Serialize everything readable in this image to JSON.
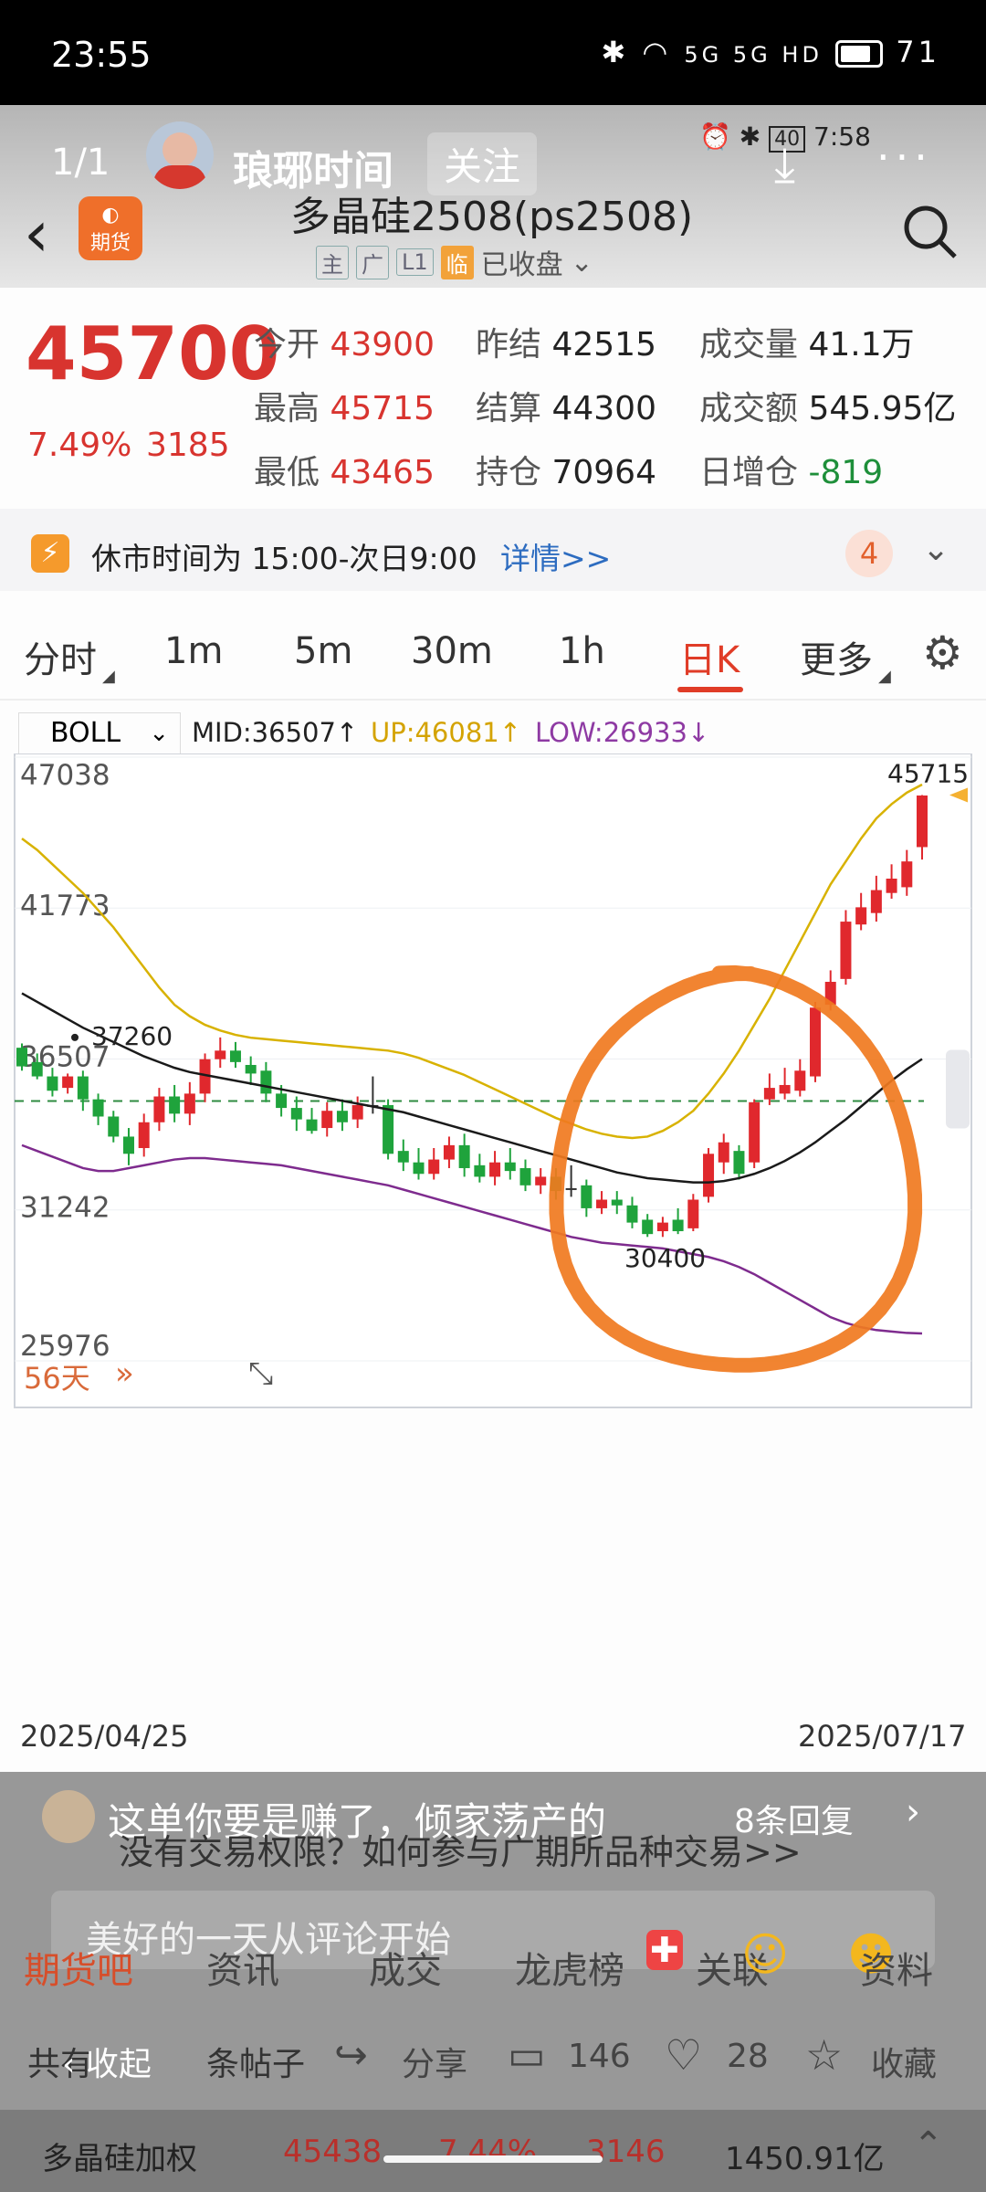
{
  "status_bar": {
    "time": "23:55",
    "battery": "71",
    "network": "5G 5G HD"
  },
  "viewer": {
    "page_counter": "1/1",
    "author": "琅琊时间",
    "follow": "关注",
    "inner_time": "7:58",
    "inner_battery": "40"
  },
  "header": {
    "title": "多晶硅2508(ps2508)",
    "logo_text": "期货",
    "badges": [
      "主",
      "广",
      "L1",
      "临"
    ],
    "status": "已收盘"
  },
  "quote": {
    "price": "45700",
    "change_pct": "7.49%",
    "change": "3185",
    "rows": [
      [
        {
          "label": "今开",
          "value": "43900",
          "color": "red"
        },
        {
          "label": "昨结",
          "value": "42515",
          "color": "dark"
        },
        {
          "label": "成交量",
          "value": "41.1万",
          "color": "dark"
        }
      ],
      [
        {
          "label": "最高",
          "value": "45715",
          "color": "red"
        },
        {
          "label": "结算",
          "value": "44300",
          "color": "dark"
        },
        {
          "label": "成交额",
          "value": "545.95亿",
          "color": "dark"
        }
      ],
      [
        {
          "label": "最低",
          "value": "43465",
          "color": "red"
        },
        {
          "label": "持仓",
          "value": "70964",
          "color": "dark"
        },
        {
          "label": "日增仓",
          "value": "-819",
          "color": "green"
        }
      ]
    ]
  },
  "notice": {
    "text": "休市时间为 15:00-次日9:00",
    "link": "详情>>",
    "count": "4"
  },
  "timeframe_tabs": [
    "分时",
    "1m",
    "5m",
    "30m",
    "1h",
    "日K",
    "更多"
  ],
  "active_tab": "日K",
  "indicator": {
    "name": "BOLL",
    "mid": "MID:36507↑",
    "up": "UP:46081↑",
    "low": "LOW:26933↓"
  },
  "chart_data": {
    "type": "candlestick",
    "x_start": "2025/04/25",
    "x_end": "2025/07/17",
    "y_ticks": [
      "47038",
      "41773",
      "36507",
      "31242",
      "25976"
    ],
    "ylim": [
      25976,
      47038
    ],
    "max_label": "45715",
    "min_label": "30400",
    "prev_label": "37260",
    "period_label": "56天",
    "candles": [
      {
        "o": 36900,
        "c": 36250,
        "h": 37050,
        "l": 36100
      },
      {
        "o": 36400,
        "c": 35900,
        "h": 36700,
        "l": 35800
      },
      {
        "o": 35900,
        "c": 35400,
        "h": 36200,
        "l": 35200
      },
      {
        "o": 35500,
        "c": 35900,
        "h": 36000,
        "l": 35300
      },
      {
        "o": 35900,
        "c": 35100,
        "h": 36100,
        "l": 34700
      },
      {
        "o": 35100,
        "c": 34500,
        "h": 35300,
        "l": 34200
      },
      {
        "o": 34500,
        "c": 33800,
        "h": 34700,
        "l": 33600
      },
      {
        "o": 33800,
        "c": 33200,
        "h": 34100,
        "l": 32800
      },
      {
        "o": 33400,
        "c": 34300,
        "h": 34600,
        "l": 33100
      },
      {
        "o": 34300,
        "c": 35200,
        "h": 35500,
        "l": 34000
      },
      {
        "o": 35200,
        "c": 34600,
        "h": 35600,
        "l": 34300
      },
      {
        "o": 34600,
        "c": 35300,
        "h": 35700,
        "l": 34200
      },
      {
        "o": 35300,
        "c": 36500,
        "h": 36700,
        "l": 35000
      },
      {
        "o": 36500,
        "c": 36800,
        "h": 37260,
        "l": 36200
      },
      {
        "o": 36800,
        "c": 36400,
        "h": 37100,
        "l": 36200
      },
      {
        "o": 36300,
        "c": 36000,
        "h": 36600,
        "l": 35600
      },
      {
        "o": 36100,
        "c": 35300,
        "h": 36400,
        "l": 35000
      },
      {
        "o": 35300,
        "c": 34800,
        "h": 35600,
        "l": 34500
      },
      {
        "o": 34800,
        "c": 34400,
        "h": 35200,
        "l": 34000
      },
      {
        "o": 34400,
        "c": 34000,
        "h": 34800,
        "l": 33900
      },
      {
        "o": 34100,
        "c": 34700,
        "h": 35000,
        "l": 33800
      },
      {
        "o": 34700,
        "c": 34300,
        "h": 35100,
        "l": 34000
      },
      {
        "o": 34400,
        "c": 34900,
        "h": 35200,
        "l": 34100
      },
      {
        "o": 34900,
        "c": 34900,
        "h": 35900,
        "l": 34600
      },
      {
        "o": 34900,
        "c": 33200,
        "h": 35100,
        "l": 33000
      },
      {
        "o": 33300,
        "c": 32900,
        "h": 33700,
        "l": 32600
      },
      {
        "o": 32900,
        "c": 32500,
        "h": 33400,
        "l": 32300
      },
      {
        "o": 32500,
        "c": 33000,
        "h": 33400,
        "l": 32300
      },
      {
        "o": 33000,
        "c": 33500,
        "h": 33800,
        "l": 32700
      },
      {
        "o": 33500,
        "c": 32700,
        "h": 33900,
        "l": 32400
      },
      {
        "o": 32800,
        "c": 32400,
        "h": 33200,
        "l": 32200
      },
      {
        "o": 32400,
        "c": 32900,
        "h": 33300,
        "l": 32100
      },
      {
        "o": 32900,
        "c": 32600,
        "h": 33400,
        "l": 32300
      },
      {
        "o": 32700,
        "c": 32100,
        "h": 33000,
        "l": 31900
      },
      {
        "o": 32100,
        "c": 32400,
        "h": 32700,
        "l": 31800
      },
      {
        "o": 32400,
        "c": 31900,
        "h": 32700,
        "l": 31600
      },
      {
        "o": 32000,
        "c": 32000,
        "h": 32800,
        "l": 31700
      },
      {
        "o": 32100,
        "c": 31300,
        "h": 32300,
        "l": 31000
      },
      {
        "o": 31300,
        "c": 31600,
        "h": 31900,
        "l": 31100
      },
      {
        "o": 31600,
        "c": 31400,
        "h": 31900,
        "l": 31100
      },
      {
        "o": 31400,
        "c": 30800,
        "h": 31700,
        "l": 30600
      },
      {
        "o": 30900,
        "c": 30400,
        "h": 31100,
        "l": 30300
      },
      {
        "o": 30500,
        "c": 30800,
        "h": 31000,
        "l": 30300
      },
      {
        "o": 30900,
        "c": 30500,
        "h": 31300,
        "l": 30400
      },
      {
        "o": 30600,
        "c": 31600,
        "h": 31800,
        "l": 30500
      },
      {
        "o": 31700,
        "c": 33200,
        "h": 33400,
        "l": 31500
      },
      {
        "o": 32900,
        "c": 33600,
        "h": 33900,
        "l": 32500
      },
      {
        "o": 33300,
        "c": 32500,
        "h": 33500,
        "l": 32300
      },
      {
        "o": 32900,
        "c": 35000,
        "h": 35100,
        "l": 32700
      },
      {
        "o": 35100,
        "c": 35500,
        "h": 36000,
        "l": 34900
      },
      {
        "o": 35300,
        "c": 35600,
        "h": 36200,
        "l": 35100
      },
      {
        "o": 35400,
        "c": 36100,
        "h": 36500,
        "l": 35200
      },
      {
        "o": 35900,
        "c": 38300,
        "h": 38500,
        "l": 35700
      },
      {
        "o": 38400,
        "c": 39200,
        "h": 39600,
        "l": 38200
      },
      {
        "o": 39300,
        "c": 41300,
        "h": 41700,
        "l": 39100
      },
      {
        "o": 41200,
        "c": 41800,
        "h": 42300,
        "l": 41000
      },
      {
        "o": 41600,
        "c": 42400,
        "h": 42900,
        "l": 41300
      },
      {
        "o": 42300,
        "c": 42800,
        "h": 43300,
        "l": 42100
      },
      {
        "o": 42500,
        "c": 43400,
        "h": 43800,
        "l": 42200
      },
      {
        "o": 43900,
        "c": 45700,
        "h": 45715,
        "l": 43465
      }
    ],
    "boll_mid": [
      38800,
      38500,
      38200,
      37900,
      37600,
      37350,
      37100,
      36850,
      36600,
      36400,
      36200,
      36050,
      35950,
      35850,
      35750,
      35650,
      35550,
      35450,
      35350,
      35250,
      35150,
      35050,
      34950,
      34850,
      34750,
      34650,
      34500,
      34350,
      34200,
      34050,
      33900,
      33750,
      33600,
      33450,
      33300,
      33150,
      33000,
      32850,
      32700,
      32550,
      32450,
      32350,
      32300,
      32250,
      32200,
      32200,
      32250,
      32350,
      32500,
      32700,
      32950,
      33250,
      33600,
      34000,
      34400,
      34850,
      35300,
      35750,
      36150,
      36507
    ],
    "boll_up": [
      44200,
      43800,
      43300,
      42800,
      42300,
      41700,
      41100,
      40400,
      39700,
      39000,
      38400,
      38000,
      37700,
      37500,
      37350,
      37250,
      37200,
      37150,
      37100,
      37050,
      37000,
      36950,
      36900,
      36850,
      36800,
      36700,
      36550,
      36350,
      36150,
      35950,
      35700,
      35450,
      35200,
      34950,
      34700,
      34450,
      34250,
      34050,
      33900,
      33800,
      33750,
      33800,
      34000,
      34300,
      34700,
      35300,
      36000,
      36800,
      37700,
      38600,
      39600,
      40600,
      41600,
      42600,
      43400,
      44200,
      44900,
      45400,
      45800,
      46081
    ],
    "boll_low": [
      33500,
      33300,
      33100,
      32900,
      32700,
      32600,
      32600,
      32700,
      32800,
      32900,
      33000,
      33050,
      33050,
      33000,
      32950,
      32900,
      32850,
      32800,
      32700,
      32600,
      32500,
      32400,
      32300,
      32200,
      32100,
      31950,
      31800,
      31650,
      31500,
      31350,
      31200,
      31050,
      30900,
      30750,
      30600,
      30450,
      30300,
      30200,
      30100,
      30050,
      30000,
      29950,
      29900,
      29800,
      29700,
      29600,
      29450,
      29250,
      29000,
      28700,
      28400,
      28100,
      27800,
      27500,
      27300,
      27150,
      27050,
      27000,
      26950,
      26933
    ]
  },
  "comments": {
    "overlay_line": "这单你要是赚了，倾家荡产的",
    "replies": "8条回复",
    "promo": "没有交易权限？如何参与广期所品种交易>>",
    "input_placeholder": "美好的一天从评论开始"
  },
  "bottom_tabs": [
    "期货吧",
    "资讯",
    "成交",
    "龙虎榜",
    "关联",
    "资料"
  ],
  "actions": {
    "collapse": "收起",
    "share": "分享",
    "comments": "146",
    "likes": "28",
    "favorite": "收藏",
    "posts_prefix": "共有",
    "posts_suffix": "条帖子"
  },
  "footer_ticker": {
    "name": "多晶硅加权",
    "price": "45438",
    "change_pct": "7.44%",
    "change": "3146",
    "amount": "1450.91亿"
  }
}
